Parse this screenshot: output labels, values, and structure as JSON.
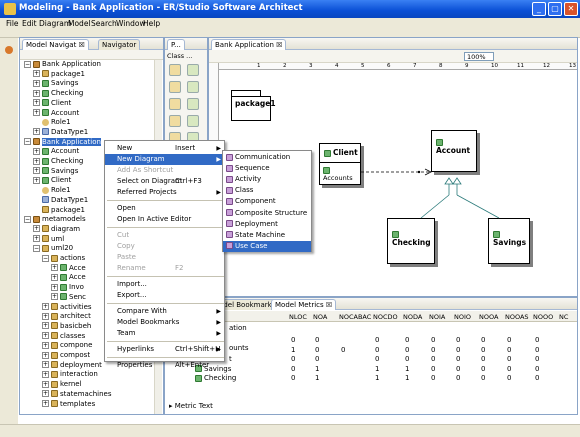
{
  "window": {
    "title": "Modeling - Bank Application - ER/Studio Software Architect"
  },
  "menubar": [
    "File",
    "Edit",
    "Diagram",
    "Model",
    "Search",
    "Window",
    "Help"
  ],
  "left_panel": {
    "tabs": [
      "Model Navigat",
      "Navigator"
    ],
    "tree": [
      {
        "label": "Bank Application",
        "icon": "model"
      },
      {
        "label": "package1",
        "icon": "pkg"
      },
      {
        "label": "Savings",
        "icon": "cls"
      },
      {
        "label": "Checking",
        "icon": "cls"
      },
      {
        "label": "Client",
        "icon": "cls"
      },
      {
        "label": "Account",
        "icon": "cls"
      },
      {
        "label": "Role1",
        "icon": "actor"
      },
      {
        "label": "DataType1",
        "icon": "type"
      },
      {
        "label": "Bank Application",
        "icon": "model"
      },
      {
        "label": "Account",
        "icon": "cls"
      },
      {
        "label": "Checking",
        "icon": "cls"
      },
      {
        "label": "Savings",
        "icon": "cls"
      },
      {
        "label": "Client",
        "icon": "cls"
      },
      {
        "label": "Role1",
        "icon": "actor"
      },
      {
        "label": "DataType1",
        "icon": "type"
      },
      {
        "label": "package1",
        "icon": "pkg"
      },
      {
        "label": "metamodels",
        "icon": "model"
      },
      {
        "label": "diagram",
        "icon": "pkg"
      },
      {
        "label": "uml",
        "icon": "pkg"
      },
      {
        "label": "uml20",
        "icon": "pkg"
      },
      {
        "label": "actions",
        "icon": "pkg"
      },
      {
        "label": "Acce",
        "icon": "cls"
      },
      {
        "label": "Acce",
        "icon": "cls"
      },
      {
        "label": "Invo",
        "icon": "cls"
      },
      {
        "label": "Senc",
        "icon": "cls"
      },
      {
        "label": "activities",
        "icon": "pkg"
      },
      {
        "label": "architect",
        "icon": "pkg"
      },
      {
        "label": "basicbeh",
        "icon": "pkg"
      },
      {
        "label": "classes",
        "icon": "pkg"
      },
      {
        "label": "compone",
        "icon": "pkg"
      },
      {
        "label": "compost",
        "icon": "pkg"
      },
      {
        "label": "deployment",
        "icon": "pkg"
      },
      {
        "label": "interaction",
        "icon": "pkg"
      },
      {
        "label": "kernel",
        "icon": "pkg"
      },
      {
        "label": "statemachines",
        "icon": "pkg"
      },
      {
        "label": "templates",
        "icon": "pkg"
      }
    ]
  },
  "palette": {
    "tabs": [
      "P...",
      "Class ..."
    ]
  },
  "editor": {
    "tab": "Bank Application",
    "zoom": "100%",
    "ruler": [
      "1",
      "2",
      "3",
      "4",
      "5",
      "6",
      "7",
      "8",
      "9",
      "10",
      "11",
      "12",
      "13"
    ],
    "package_label": "package1",
    "classes": {
      "client": "Client",
      "client_attr": "Accounts",
      "account": "Account",
      "checking": "Checking",
      "savings": "Savings"
    }
  },
  "context_menu": [
    {
      "label": "New",
      "accel": "Insert",
      "sub": true
    },
    {
      "label": "New Diagram",
      "sub": true,
      "highlight": true
    },
    {
      "label": "Add As Shortcut",
      "disabled": true
    },
    {
      "label": "Select on Diagram",
      "accel": "Ctrl+F3"
    },
    {
      "label": "Referred Projects",
      "sub": true
    },
    {
      "sep": true
    },
    {
      "label": "Open"
    },
    {
      "label": "Open In Active Editor"
    },
    {
      "sep": true
    },
    {
      "label": "Cut",
      "disabled": true
    },
    {
      "label": "Copy",
      "disabled": true
    },
    {
      "label": "Paste",
      "disabled": true
    },
    {
      "label": "Rename",
      "accel": "F2",
      "disabled": true
    },
    {
      "sep": true
    },
    {
      "label": "Import..."
    },
    {
      "label": "Export..."
    },
    {
      "sep": true
    },
    {
      "label": "Compare With",
      "sub": true
    },
    {
      "label": "Model Bookmarks",
      "sub": true
    },
    {
      "label": "Team",
      "sub": true
    },
    {
      "sep": true
    },
    {
      "label": "Hyperlinks",
      "accel": "Ctrl+Shift+H",
      "sub": true
    },
    {
      "sep": true
    },
    {
      "label": "Properties",
      "accel": "Alt+Enter"
    }
  ],
  "submenu": [
    {
      "label": "Communication"
    },
    {
      "label": "Sequence"
    },
    {
      "label": "Activity"
    },
    {
      "label": "Class"
    },
    {
      "label": "Component"
    },
    {
      "label": "Composite Structure"
    },
    {
      "label": "Deployment"
    },
    {
      "label": "State Machine"
    },
    {
      "label": "Use Case",
      "highlight": true
    }
  ],
  "bottom_panel": {
    "tabs": [
      "Model Bookmarks",
      "Model Metrics"
    ],
    "columns": [
      "NLOC",
      "NOA",
      "NOCABAC",
      "NOCDO",
      "NODA",
      "NOIA",
      "NOIO",
      "NOOA",
      "NOOAS",
      "NOOO",
      "NC"
    ],
    "partial_labels": [
      "ation",
      "ounts",
      "t"
    ],
    "rows": [
      {
        "label": "",
        "values": [
          "0",
          "0",
          "",
          "0",
          "0",
          "0",
          "0",
          "0",
          "0",
          "0"
        ]
      },
      {
        "label": "",
        "values": [
          "1",
          "0",
          "0",
          "0",
          "0",
          "0",
          "0",
          "0",
          "0",
          "0"
        ]
      },
      {
        "label": "",
        "values": [
          "0",
          "0",
          "",
          "0",
          "0",
          "0",
          "0",
          "0",
          "0",
          "0"
        ]
      },
      {
        "label": "Savings",
        "values": [
          "0",
          "1",
          "",
          "1",
          "1",
          "0",
          "0",
          "0",
          "0",
          "0"
        ]
      },
      {
        "label": "Checking",
        "values": [
          "0",
          "1",
          "",
          "1",
          "1",
          "0",
          "0",
          "0",
          "0",
          "0"
        ]
      }
    ],
    "footer": "Metric Text"
  },
  "colors": {
    "title_blue": "#0a4fd5",
    "selection": "#316ac5",
    "chrome": "#ece9d8"
  }
}
